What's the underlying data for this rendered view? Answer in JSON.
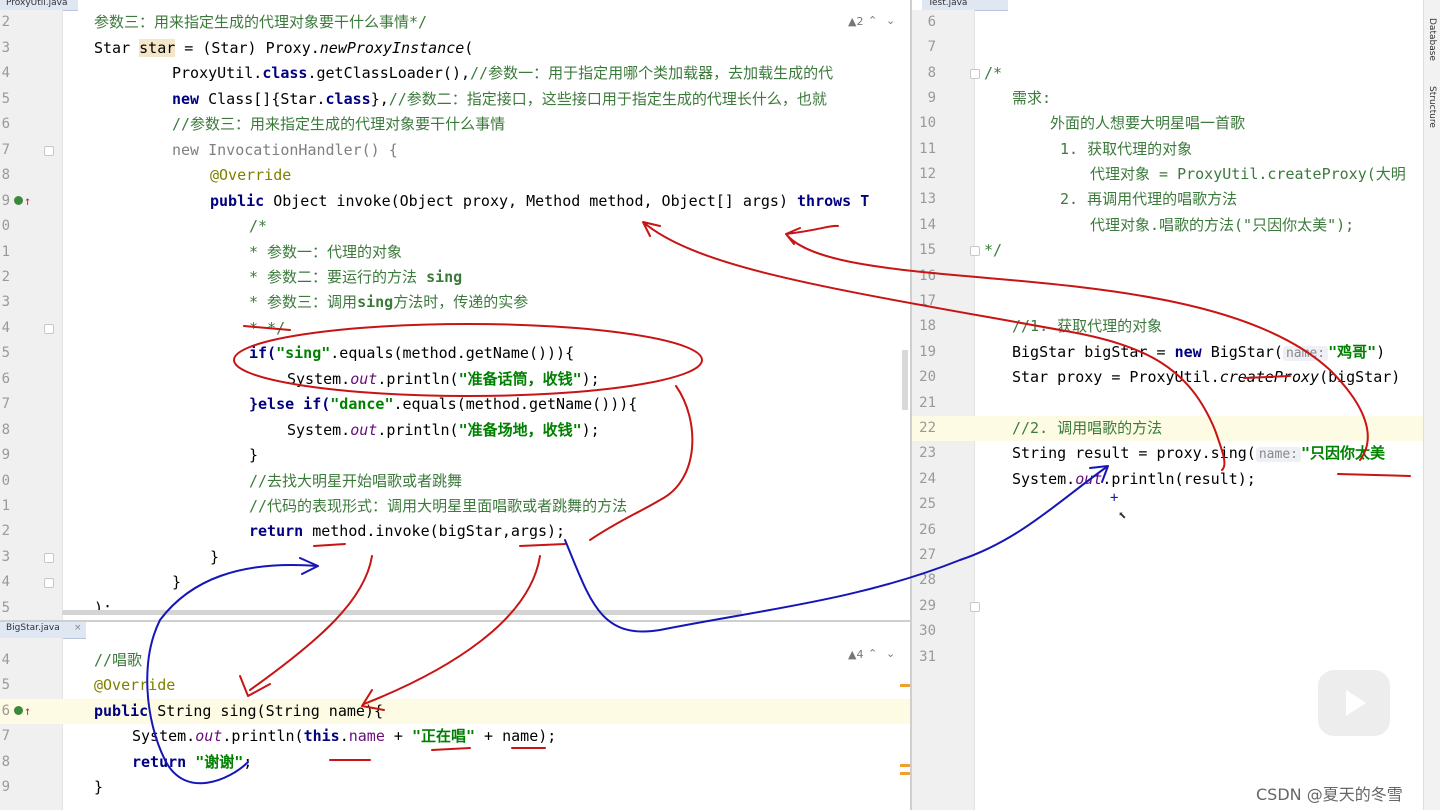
{
  "tabs": {
    "top_left": "ProxyUtil.java",
    "bottom_left": "BigStar.java",
    "right": "Test.java"
  },
  "warnings": {
    "top": "▲2",
    "bottom": "▲4"
  },
  "side_panel": {
    "database": "Database",
    "structure": "Structure"
  },
  "watermark": "CSDN @夏天的冬雪",
  "proxy_util_lines": [
    {
      "num": "2"
    },
    {
      "num": "3"
    },
    {
      "num": "4"
    },
    {
      "num": "5"
    },
    {
      "num": "6"
    },
    {
      "num": "7"
    },
    {
      "num": "8"
    },
    {
      "num": "9"
    },
    {
      "num": "0"
    },
    {
      "num": "1"
    },
    {
      "num": "2"
    },
    {
      "num": "3"
    },
    {
      "num": "4"
    },
    {
      "num": "5"
    },
    {
      "num": "6"
    },
    {
      "num": "7"
    },
    {
      "num": "8"
    },
    {
      "num": "9"
    },
    {
      "num": "0"
    },
    {
      "num": "1"
    },
    {
      "num": "2"
    },
    {
      "num": "3"
    },
    {
      "num": "4"
    },
    {
      "num": "5"
    }
  ],
  "proxy_util_code": {
    "l2": "参数三：用来指定生成的代理对象要干什么事情*/",
    "l3_a": "Star ",
    "l3_b": "star",
    "l3_c": " = (Star) Proxy.",
    "l3_d": "newProxyInstance",
    "l3_e": "(",
    "l4_a": "ProxyUtil.",
    "l4_b": "class",
    "l4_c": ".getClassLoader(),",
    "l4_d": "//参数一：用于指定用哪个类加载器，去加载生成的代",
    "l5_a": "new ",
    "l5_b": "Class[]{Star.",
    "l5_c": "class",
    "l5_d": "},",
    "l5_e": "//参数二：指定接口，这些接口用于指定生成的代理长什么，也就",
    "l6": "//参数三：用来指定生成的代理对象要干什么事情",
    "l7_a": "new ",
    "l7_b": "InvocationHandler() {",
    "l8": "@Override",
    "l9_a": "public ",
    "l9_b": "Object invoke(Object proxy, Method method, Object[] args) ",
    "l9_c": "throws T",
    "l10": "/*",
    "l11": "* 参数一：代理的对象",
    "l12_a": "* 参数二：要运行的方法 ",
    "l12_b": "sing",
    "l13_a": "* 参数三：调用",
    "l13_b": "sing",
    "l13_c": "方法时，传递的实参",
    "l14": "* */",
    "l15_a": "if(",
    "l15_b": "\"sing\"",
    "l15_c": ".equals(method.getName())){",
    "l16_a": "System.",
    "l16_b": "out",
    "l16_c": ".println(",
    "l16_d": "\"准备话筒，收钱\"",
    "l16_e": ");",
    "l17_a": "}else if(",
    "l17_b": "\"dance\"",
    "l17_c": ".equals(method.getName())){",
    "l18_a": "System.",
    "l18_b": "out",
    "l18_c": ".println(",
    "l18_d": "\"准备场地，收钱\"",
    "l18_e": ");",
    "l19": "}",
    "l20": "//去找大明星开始唱歌或者跳舞",
    "l21": "//代码的表现形式：调用大明星里面唱歌或者跳舞的方法",
    "l22_a": "return ",
    "l22_b": "method.invoke(bigStar,args);",
    "l23": "}",
    "l24": "}",
    "l25": ");"
  },
  "bigstar_lines": [
    {
      "num": "4"
    },
    {
      "num": "5"
    },
    {
      "num": "6"
    },
    {
      "num": "7"
    },
    {
      "num": "8"
    },
    {
      "num": "9"
    }
  ],
  "bigstar_code": {
    "l4": "//唱歌",
    "l5": "@Override",
    "l6_a": "public ",
    "l6_b": "String sing(String name){",
    "l7_a": "System.",
    "l7_b": "out",
    "l7_c": ".println(",
    "l7_d": "this",
    "l7_e": ".",
    "l7_f": "name",
    "l7_g": " + ",
    "l7_h": "\"正在唱\"",
    "l7_i": " + name);",
    "l8_a": "return ",
    "l8_b": "\"谢谢\"",
    "l8_c": ";",
    "l9": "}"
  },
  "test_lines": [
    {
      "num": "6"
    },
    {
      "num": "7"
    },
    {
      "num": "8"
    },
    {
      "num": "9"
    },
    {
      "num": "10"
    },
    {
      "num": "11"
    },
    {
      "num": "12"
    },
    {
      "num": "13"
    },
    {
      "num": "14"
    },
    {
      "num": "15"
    },
    {
      "num": "16"
    },
    {
      "num": "17"
    },
    {
      "num": "18"
    },
    {
      "num": "19"
    },
    {
      "num": "20"
    },
    {
      "num": "21"
    },
    {
      "num": "22"
    },
    {
      "num": "23"
    },
    {
      "num": "24"
    },
    {
      "num": "25"
    },
    {
      "num": "26"
    },
    {
      "num": "27"
    },
    {
      "num": "28"
    },
    {
      "num": "29"
    },
    {
      "num": "30"
    },
    {
      "num": "31"
    }
  ],
  "test_code": {
    "l8": "/*",
    "l9": "需求:",
    "l10": "外面的人想要大明星唱一首歌",
    "l11": "1. 获取代理的对象",
    "l12_a": "代理对象 = ProxyUtil.",
    "l12_b": "createProxy",
    "l12_c": "(大明",
    "l13": "2. 再调用代理的唱歌方法",
    "l14": "代理对象.唱歌的方法(\"只因你太美\");",
    "l15": "*/",
    "l18": "//1. 获取代理的对象",
    "l19_a": "BigStar bigStar = ",
    "l19_b": "new ",
    "l19_c": "BigStar(",
    "l19_d": "name:",
    "l19_e": "\"鸡哥\"",
    "l19_f": ")",
    "l20_a": "Star proxy = ProxyUtil.",
    "l20_b": "createProxy",
    "l20_c": "(bigStar)",
    "l22": "//2. 调用唱歌的方法",
    "l23_a": "String result = proxy.sing(",
    "l23_b": "name:",
    "l23_c": "\"只因你太美",
    "l24_a": "System.",
    "l24_b": "out",
    "l24_c": ".println(result);"
  },
  "annotation_colors": {
    "red": "#c81414",
    "blue": "#1616b8"
  }
}
